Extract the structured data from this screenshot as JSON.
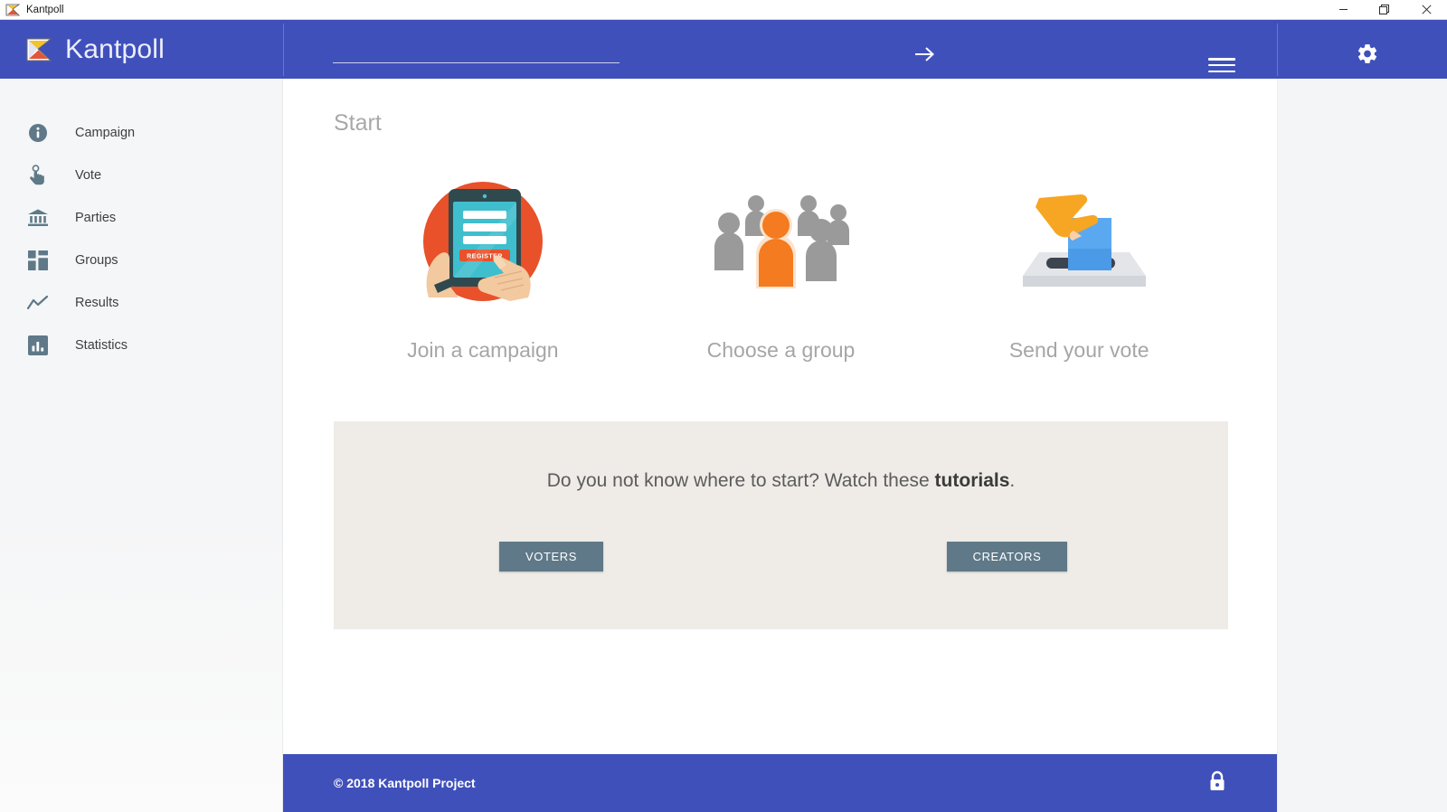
{
  "window": {
    "title": "Kantpoll",
    "icon": "kantpoll-logo-icon",
    "controls": {
      "minimize": "—",
      "maximize": "❐",
      "close": "✕"
    }
  },
  "header": {
    "brand": "Kantpoll",
    "brand_icon": "kantpoll-logo-icon",
    "search": {
      "value": "",
      "placeholder": ""
    },
    "submit_icon": "arrow-right-icon",
    "menu_icon": "hamburger-menu-icon",
    "settings_icon": "gear-icon",
    "background": "#4050bb"
  },
  "sidebar": {
    "items": [
      {
        "label": "Campaign",
        "icon": "info-circle-icon"
      },
      {
        "label": "Vote",
        "icon": "hand-pointer-icon"
      },
      {
        "label": "Parties",
        "icon": "bank-columns-icon"
      },
      {
        "label": "Groups",
        "icon": "grid-blocks-icon"
      },
      {
        "label": "Results",
        "icon": "line-chart-icon"
      },
      {
        "label": "Statistics",
        "icon": "bar-chart-icon"
      }
    ]
  },
  "main": {
    "page_title": "Start",
    "features": [
      {
        "caption": "Join a campaign",
        "icon": "register-tablet-icon",
        "register_label": "REGISTER"
      },
      {
        "caption": "Choose a group",
        "icon": "people-group-icon"
      },
      {
        "caption": "Send your vote",
        "icon": "ballot-box-icon"
      }
    ],
    "tutorials": {
      "text_before": "Do you not know where to start? Watch these ",
      "text_bold": "tutorials",
      "text_after": ".",
      "voters_label": "VOTERS",
      "creators_label": "CREATORS",
      "panel_background": "#efece8",
      "button_color": "#5f7988"
    }
  },
  "footer": {
    "copyright": "© 2018 Kantpoll Project",
    "lock_icon": "padlock-closed-icon"
  },
  "colors": {
    "brand_blue": "#4050bb",
    "accent_orange": "#f47b20",
    "icon_slate": "#5f7988",
    "panel_beige": "#efece8"
  }
}
